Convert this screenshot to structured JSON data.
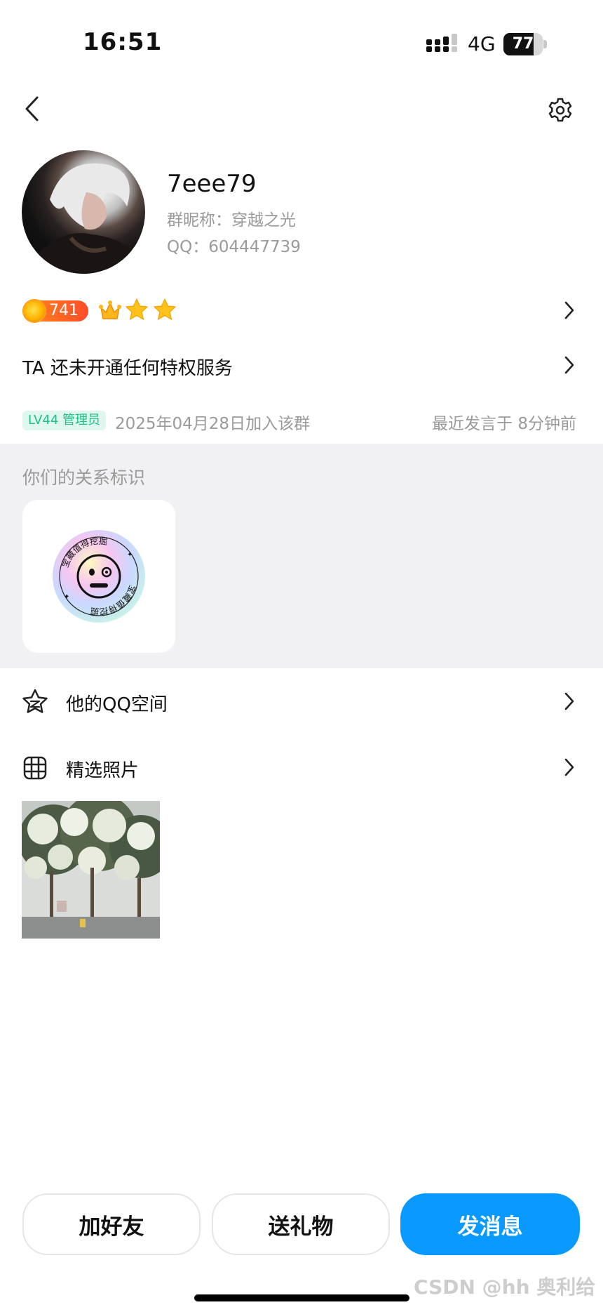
{
  "status_bar": {
    "time": "16:51",
    "network": "4G",
    "battery": "77",
    "battery_level": 0.77
  },
  "profile": {
    "nickname": "7eee79",
    "group_nickname": "群昵称：穿越之光",
    "qq_number": "QQ：604447739"
  },
  "badges": {
    "level_value": "741",
    "icons": [
      "coin-icon",
      "crown-icon",
      "star-icon",
      "star-icon"
    ]
  },
  "privilege": {
    "text": "TA 还未开通任何特权服务"
  },
  "group_info": {
    "level_tag": "LV44 管理员",
    "join_date": "2025年04月28日加入该群",
    "last_speak": "最近发言于 8分钟前"
  },
  "relation": {
    "title": "你们的关系标识",
    "badge_text_top": "宝藏值得挖掘",
    "badge_text_bottom": "宝藏值得挖掘"
  },
  "rows": {
    "qzone": "他的QQ空间",
    "photos": "精选照片"
  },
  "buttons": {
    "add_friend": "加好友",
    "send_gift": "送礼物",
    "send_message": "发消息"
  },
  "watermark": "CSDN @hh 奥利给",
  "colors": {
    "accent": "#0A99FF",
    "level_tag_bg": "#DFF7EF",
    "level_tag_text": "#1CC08A",
    "section_bg": "#F1F1F4",
    "secondary_text": "#9A9A9A"
  }
}
